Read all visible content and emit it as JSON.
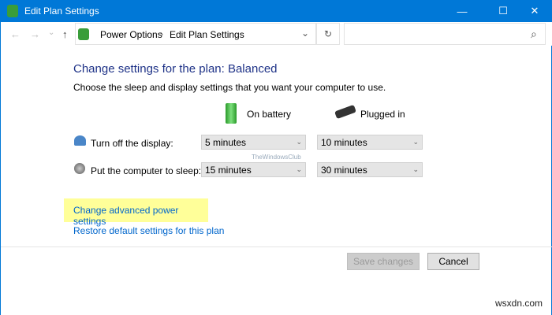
{
  "window": {
    "title": "Edit Plan Settings",
    "minimize": "—",
    "maximize": "☐",
    "close": "✕"
  },
  "address": {
    "back": "←",
    "forward": "→",
    "recent": "⌄",
    "up": "↑",
    "crumbs": [
      "Power Options",
      "Edit Plan Settings"
    ],
    "sep": "›",
    "dropdown": "⌄",
    "refresh": "↻",
    "search_icon": "⌕"
  },
  "main": {
    "title": "Change settings for the plan: Balanced",
    "subtitle": "Choose the sleep and display settings that you want your computer to use.",
    "columns": {
      "battery": "On battery",
      "plugged": "Plugged in"
    },
    "rows": [
      {
        "label": "Turn off the display:",
        "battery": "5 minutes",
        "plugged": "10 minutes"
      },
      {
        "label": "Put the computer to sleep:",
        "battery": "15 minutes",
        "plugged": "30 minutes"
      }
    ],
    "advanced_link": "Change advanced power settings",
    "restore_link": "Restore default settings for this plan",
    "watermark": "TheWindowsClub",
    "highlight_color": "#ffff99"
  },
  "buttons": {
    "save": "Save changes",
    "cancel": "Cancel"
  },
  "footer_watermark": "wsxdn.com"
}
